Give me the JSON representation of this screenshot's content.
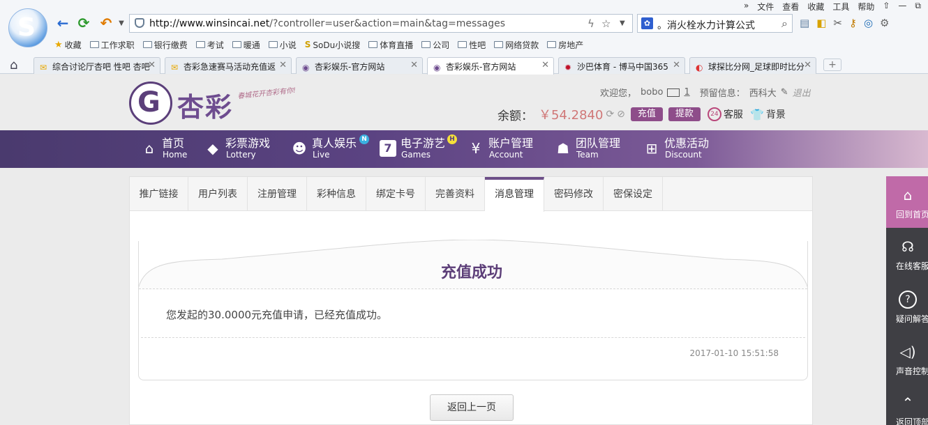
{
  "browser": {
    "menu": [
      "»",
      "文件",
      "查看",
      "收藏",
      "工具",
      "帮助",
      "⇧",
      "—",
      "⧉"
    ],
    "url_domain": "http://www.winsincai.net",
    "url_rest": "/?controller=user&action=main&tag=messages",
    "search_text": "。消火栓水力计算公式",
    "bookmarks": [
      "收藏",
      "工作求职",
      "银行缴费",
      "考试",
      "暖通",
      "小说",
      "SoDu小说搜",
      "体育直播",
      "公司",
      "性吧",
      "网络贷款",
      "房地产"
    ],
    "tabs": [
      {
        "label": "综合讨论厅杏吧 性吧 杏吧"
      },
      {
        "label": "杏彩急速赛马活动充值返"
      },
      {
        "label": "杏彩娱乐-官方网站"
      },
      {
        "label": "杏彩娱乐-官方网站"
      },
      {
        "label": "沙巴体育 - 博马中国365"
      },
      {
        "label": "球探比分网_足球即时比分"
      }
    ],
    "new_tab": "+"
  },
  "header": {
    "brand": "杏彩",
    "slogan": "春城花开杏彩有你!",
    "welcome": "欢迎您，",
    "username": "bobo",
    "msg_count": "1",
    "reserve_info_label": "预留信息：",
    "reserve_info": "西科大",
    "logout": "退出",
    "balance_label": "余额：",
    "balance": "￥54.2840",
    "recharge": "充值",
    "withdraw": "提款",
    "service": "客服",
    "background": "背景"
  },
  "nav": [
    {
      "title": "首页",
      "sub": "Home",
      "icon": "home-icon"
    },
    {
      "title": "彩票游戏",
      "sub": "Lottery",
      "icon": "lottery-icon"
    },
    {
      "title": "真人娱乐",
      "sub": "Live",
      "icon": "live-icon",
      "badge": "N"
    },
    {
      "title": "电子游艺",
      "sub": "Games",
      "icon": "games-icon",
      "badge": "H"
    },
    {
      "title": "账户管理",
      "sub": "Account",
      "icon": "account-icon"
    },
    {
      "title": "团队管理",
      "sub": "Team",
      "icon": "team-icon"
    },
    {
      "title": "优惠活动",
      "sub": "Discount",
      "icon": "gift-icon"
    }
  ],
  "subtabs": [
    "推广链接",
    "用户列表",
    "注册管理",
    "彩种信息",
    "绑定卡号",
    "完善资料",
    "消息管理",
    "密码修改",
    "密保设定"
  ],
  "active_subtab": "消息管理",
  "message": {
    "title": "充值成功",
    "body": "您发起的30.0000元充值申请，已经充值成功。",
    "date": "2017-01-10 15:51:58"
  },
  "back_button": "返回上一页",
  "floatbar": [
    {
      "label": "回到首页",
      "icon": "home-icon"
    },
    {
      "label": "在线客服",
      "icon": "headset-icon"
    },
    {
      "label": "疑问解答",
      "icon": "question-icon"
    },
    {
      "label": "声音控制",
      "icon": "speaker-icon"
    },
    {
      "label": "返回顶部",
      "icon": "back-to-top-icon"
    }
  ],
  "colors": {
    "brand_purple": "#5c3e78",
    "button_purple": "#8e4d8a",
    "balance_red": "#d07777",
    "float_pink": "#c06aa8"
  }
}
